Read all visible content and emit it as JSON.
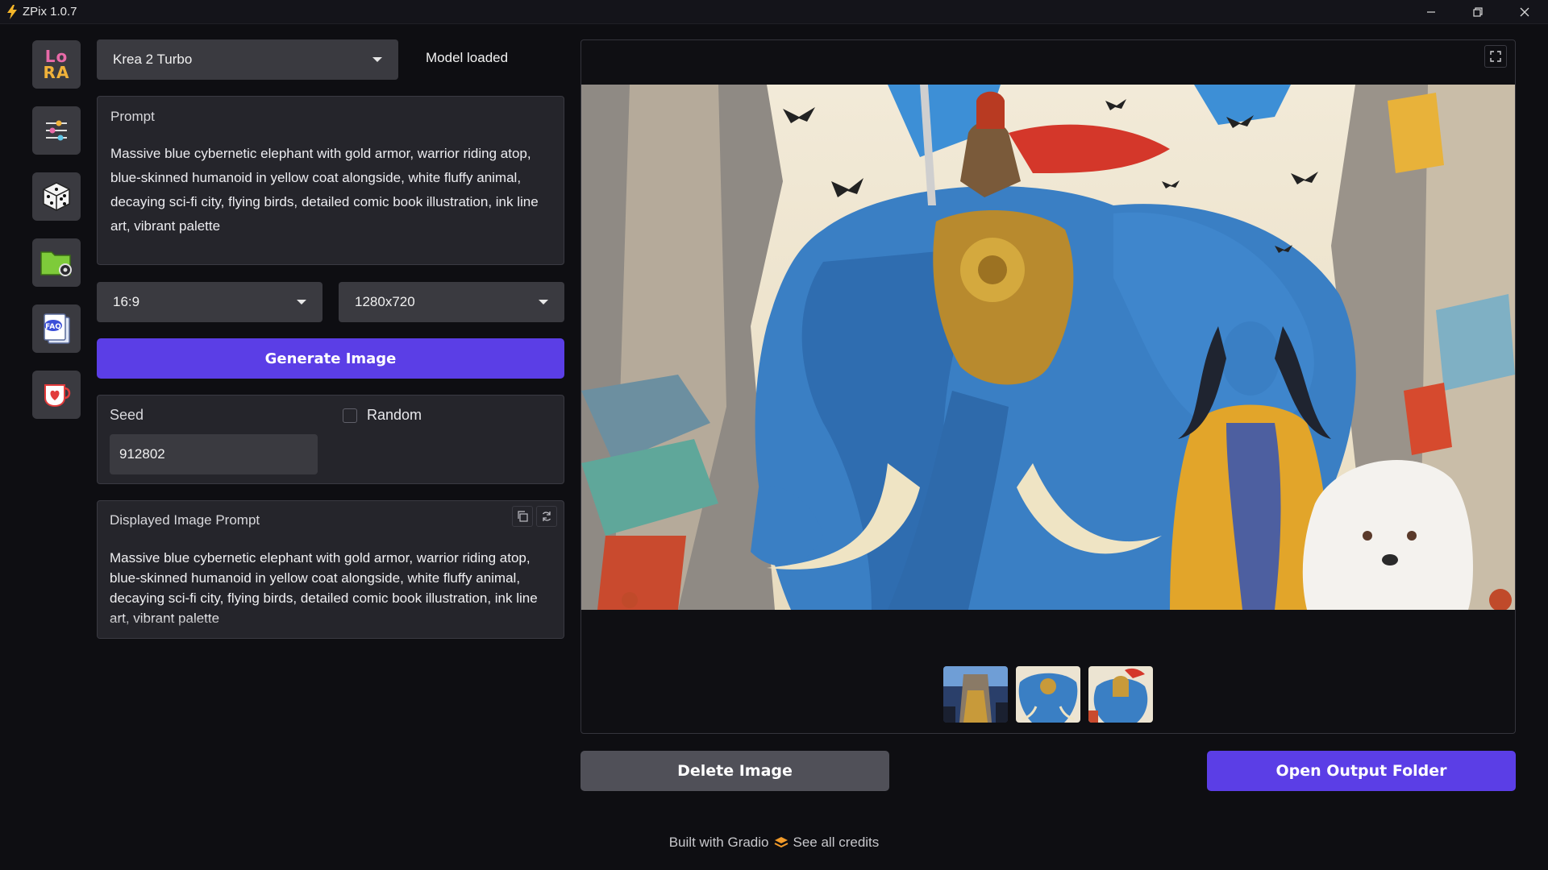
{
  "window": {
    "title": "ZPix 1.0.7"
  },
  "sidebar": {
    "lora": {
      "line1": "Lo",
      "line2": "RA"
    },
    "items": [
      "lora-icon",
      "sliders-icon",
      "dice-icon",
      "folder-settings-icon",
      "faq-icon",
      "support-cup-icon"
    ],
    "faq_label": "FAQ"
  },
  "model": {
    "selected": "Krea 2 Turbo",
    "status": "Model loaded"
  },
  "prompt": {
    "label": "Prompt",
    "value": "Massive blue cybernetic elephant with gold armor, warrior riding atop, blue-skinned humanoid in yellow coat alongside, white fluffy animal, decaying sci-fi city, flying birds, detailed comic book illustration, ink line art, vibrant palette"
  },
  "aspect": {
    "selected": "16:9"
  },
  "resolution": {
    "selected": "1280x720"
  },
  "generate": {
    "label": "Generate Image"
  },
  "seed": {
    "label": "Seed",
    "value": "912802",
    "random_label": "Random",
    "random_checked": false
  },
  "displayed_prompt": {
    "label": "Displayed Image Prompt",
    "value": "Massive blue cybernetic elephant with gold armor, warrior riding atop, blue-skinned humanoid in yellow coat alongside, white fluffy animal, decaying sci-fi city, flying birds, detailed comic book illustration, ink line art, vibrant palette"
  },
  "gallery": {
    "thumbnail_count": 3
  },
  "actions": {
    "delete": "Delete Image",
    "open_folder": "Open Output Folder"
  },
  "footer": {
    "built_with": "Built with Gradio",
    "credits": "See all credits"
  },
  "colors": {
    "accent": "#5b3ee6",
    "panel": "#25252b",
    "input": "#3a3a40",
    "background": "#0e0e12"
  }
}
